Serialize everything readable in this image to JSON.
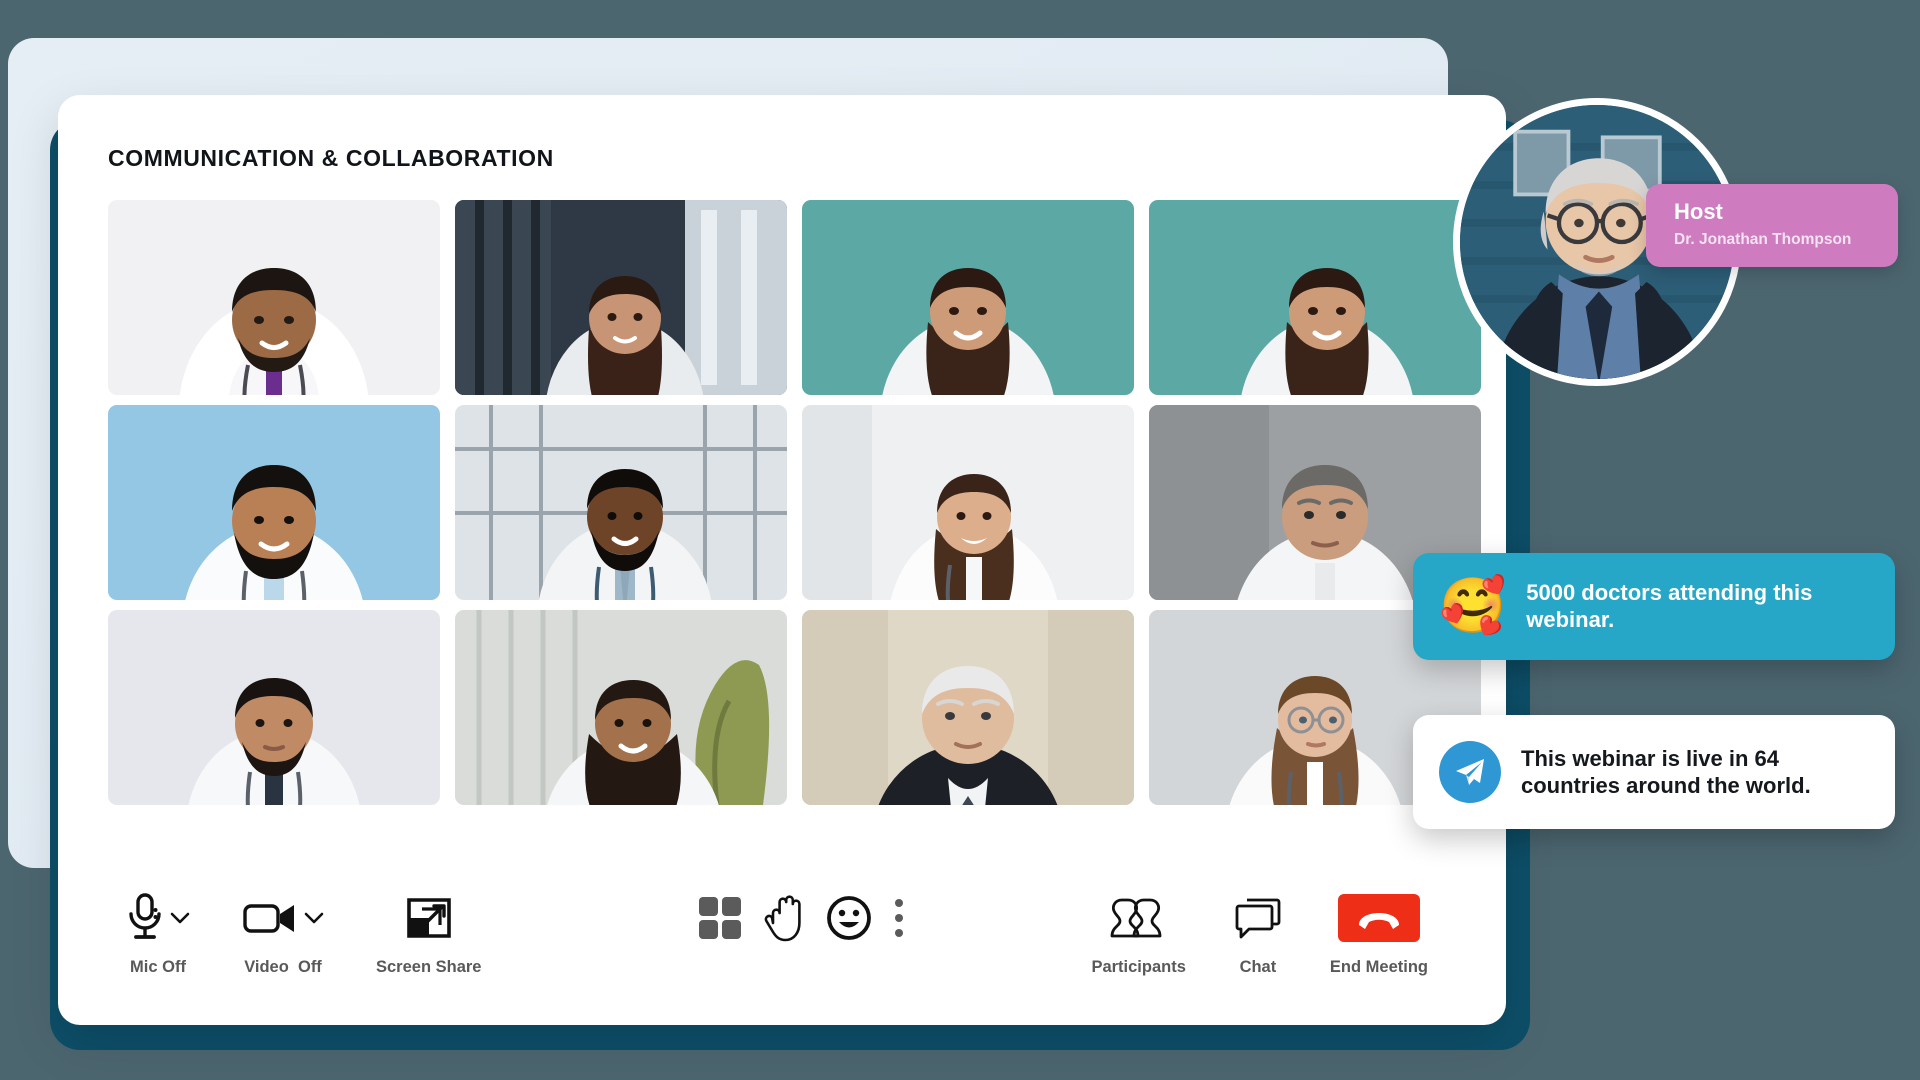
{
  "page": {
    "background_color": "#4C6670",
    "accent_teal": "#0D4F68",
    "back_panel_color": "#E6EEF5"
  },
  "console": {
    "title": "COMMUNICATION & COLLABORATION",
    "card_color": "#FFFFFF"
  },
  "video_grid": {
    "rows": 3,
    "columns": 4,
    "tiles": [
      {
        "id": "tile-1",
        "icon": "participant-video-tile",
        "background": "#F0F0F3",
        "description": "male doctor white coat stethoscope light background"
      },
      {
        "id": "tile-2",
        "icon": "participant-video-tile",
        "background": "#3C4651",
        "description": "female doctor corridor dark background"
      },
      {
        "id": "tile-3",
        "icon": "participant-video-tile",
        "background": "#5BA8A5",
        "description": "female doctor teal background"
      },
      {
        "id": "tile-4",
        "icon": "participant-video-tile",
        "background": "#5BA8A5",
        "description": "female doctor teal background"
      },
      {
        "id": "tile-5",
        "icon": "participant-video-tile",
        "background": "#8EC6E3",
        "description": "bearded male doctor light blue background"
      },
      {
        "id": "tile-6",
        "icon": "participant-video-tile",
        "background": "#D8DDE2",
        "description": "male doctor tie office window background"
      },
      {
        "id": "tile-7",
        "icon": "participant-video-tile",
        "background": "#EDEFF1",
        "description": "smiling female doctor bright background"
      },
      {
        "id": "tile-8",
        "icon": "participant-video-tile",
        "background": "#9A9C9E",
        "description": "grey haired male doctor neutral background"
      },
      {
        "id": "tile-9",
        "icon": "participant-video-tile",
        "background": "#E6E7EC",
        "description": "young male doctor plain background"
      },
      {
        "id": "tile-10",
        "icon": "participant-video-tile",
        "background": "#D3D5D0",
        "description": "curly haired female doctor with plant"
      },
      {
        "id": "tile-11",
        "icon": "participant-video-tile",
        "background": "#DCD6C4",
        "description": "elderly man in suit and tie"
      },
      {
        "id": "tile-12",
        "icon": "participant-video-tile",
        "background": "#D6D8D9",
        "description": "female doctor with glasses looking aside"
      }
    ]
  },
  "controls": {
    "left": [
      {
        "id": "mic",
        "label": "Mic Off",
        "icon": "microphone-icon",
        "has_chevron": true
      },
      {
        "id": "video",
        "label": "Video  Off",
        "icon": "video-camera-icon",
        "has_chevron": true
      },
      {
        "id": "screen-share",
        "label": "Screen Share",
        "icon": "screen-share-icon",
        "has_chevron": false
      }
    ],
    "middle": [
      {
        "id": "grid-view",
        "icon": "grid-view-icon",
        "color": "#5B5B5B"
      },
      {
        "id": "raise-hand",
        "icon": "raise-hand-icon",
        "color": "#111111"
      },
      {
        "id": "reactions",
        "icon": "smiley-face-icon",
        "color": "#111111"
      },
      {
        "id": "more-options",
        "icon": "more-vertical-icon",
        "color": "#5B5B5B"
      }
    ],
    "right": [
      {
        "id": "participants",
        "label": "Participants",
        "icon": "participants-icon"
      },
      {
        "id": "chat",
        "label": "Chat",
        "icon": "chat-bubble-icon"
      },
      {
        "id": "end-meeting",
        "label": "End Meeting",
        "icon": "hangup-phone-icon",
        "button_color": "#EE2E16"
      }
    ]
  },
  "host": {
    "role": "Host",
    "name": "Dr. Jonathan Thompson",
    "badge_color": "#CE7BC0",
    "avatar_icon": "host-avatar-photo"
  },
  "notifications": [
    {
      "id": "attendance",
      "icon": "smiling-face-with-hearts-emoji",
      "emoji": "🥰",
      "text": "5000 doctors attending this webinar.",
      "background": "#27A7C7",
      "text_color": "#FFFFFF"
    },
    {
      "id": "countries",
      "icon": "paper-plane-icon",
      "text": "This webinar is live in 64 countries around the world.",
      "background": "#FFFFFF",
      "text_color": "#15181C",
      "icon_background": "#2E97D4"
    }
  ]
}
